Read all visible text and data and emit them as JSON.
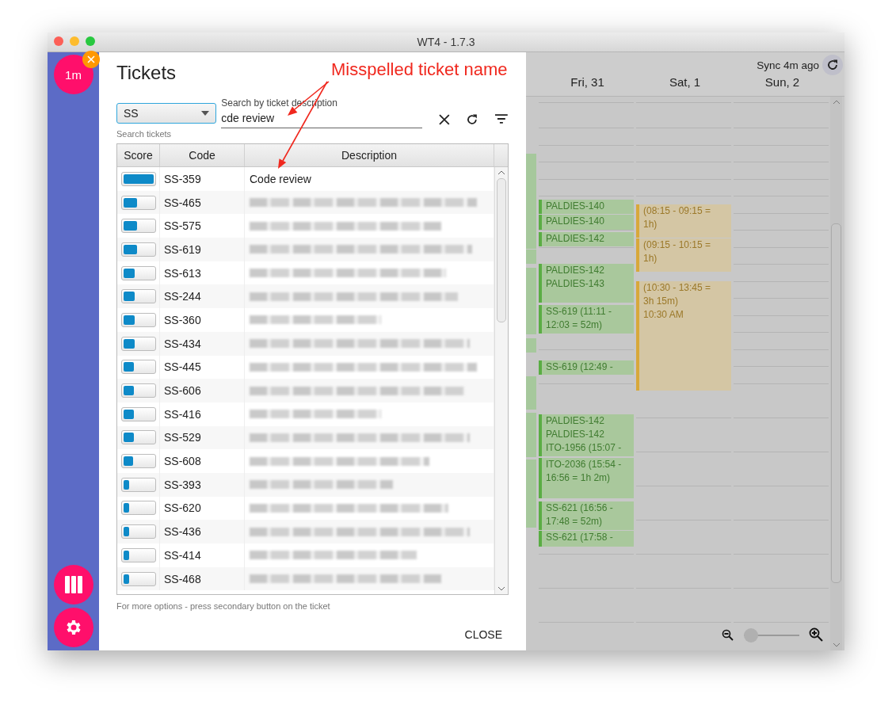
{
  "window": {
    "title": "WT4 - 1.7.3"
  },
  "sidebar": {
    "avatar_label": "1m"
  },
  "dialog": {
    "title": "Tickets",
    "project_select": {
      "value": "SS"
    },
    "search": {
      "label": "Search by ticket description",
      "value": "cde review"
    },
    "helper": "Search tickets",
    "table": {
      "columns": [
        "Score",
        "Code",
        "Description"
      ],
      "rows": [
        {
          "level": 1.0,
          "code": "SS-359",
          "description": "Code review"
        },
        {
          "level": 0.45,
          "code": "SS-465"
        },
        {
          "level": 0.45,
          "code": "SS-575"
        },
        {
          "level": 0.45,
          "code": "SS-619"
        },
        {
          "level": 0.38,
          "code": "SS-613"
        },
        {
          "level": 0.38,
          "code": "SS-244"
        },
        {
          "level": 0.38,
          "code": "SS-360"
        },
        {
          "level": 0.38,
          "code": "SS-434"
        },
        {
          "level": 0.35,
          "code": "SS-445"
        },
        {
          "level": 0.35,
          "code": "SS-606"
        },
        {
          "level": 0.35,
          "code": "SS-416"
        },
        {
          "level": 0.35,
          "code": "SS-529"
        },
        {
          "level": 0.32,
          "code": "SS-608"
        },
        {
          "level": 0.2,
          "code": "SS-393"
        },
        {
          "level": 0.2,
          "code": "SS-620"
        },
        {
          "level": 0.2,
          "code": "SS-436"
        },
        {
          "level": 0.2,
          "code": "SS-414"
        },
        {
          "level": 0.2,
          "code": "SS-468"
        }
      ]
    },
    "hint": "For more options - press secondary button on the ticket",
    "close_button": "CLOSE"
  },
  "calendar": {
    "sync_label": "Sync 4m ago",
    "days": [
      {
        "label": "Fri, 31",
        "events": [
          {
            "color": "#5aad44",
            "lines": [
              "PALDIES-140"
            ]
          },
          {
            "color": "#5aad44",
            "lines": [
              "PALDIES-140"
            ]
          },
          {
            "color": "#5aad44",
            "lines": [
              "PALDIES-142"
            ]
          },
          {
            "color": "#5aad44",
            "lines": [
              "PALDIES-142",
              "PALDIES-143"
            ]
          },
          {
            "color": "#5aad44",
            "lines": [
              "SS-619 (11:11 - 12:03 = 52m)"
            ]
          },
          {
            "color": "#5aad44",
            "lines": [
              "SS-619 (12:49 -"
            ]
          },
          {
            "color": "#5aad44",
            "lines": [
              "PALDIES-142",
              "PALDIES-142",
              "ITO-1956 (15:07 -"
            ]
          },
          {
            "color": "#5aad44",
            "lines": [
              "ITO-2036 (15:54 - 16:56 = 1h 2m)"
            ]
          },
          {
            "color": "#5aad44",
            "lines": [
              "SS-621 (16:56 - 17:48 = 52m)"
            ]
          },
          {
            "color": "#5aad44",
            "lines": [
              "SS-621 (17:58 -"
            ]
          }
        ]
      },
      {
        "label": "Sat, 1",
        "events": [
          {
            "color": "#d8a83a",
            "lines": [
              "(08:15 - 09:15 = 1h)"
            ]
          },
          {
            "color": "#d8a83a",
            "lines": [
              "(09:15 - 10:15 = 1h)"
            ]
          },
          {
            "color": "#d8a83a",
            "lines": [
              "(10:30 - 13:45 = 3h 15m)",
              "10:30 AM"
            ]
          }
        ]
      },
      {
        "label": "Sun, 2"
      }
    ]
  },
  "zoom": {
    "level": 0.0
  },
  "annotation": {
    "text": "Misspelled ticket name"
  }
}
